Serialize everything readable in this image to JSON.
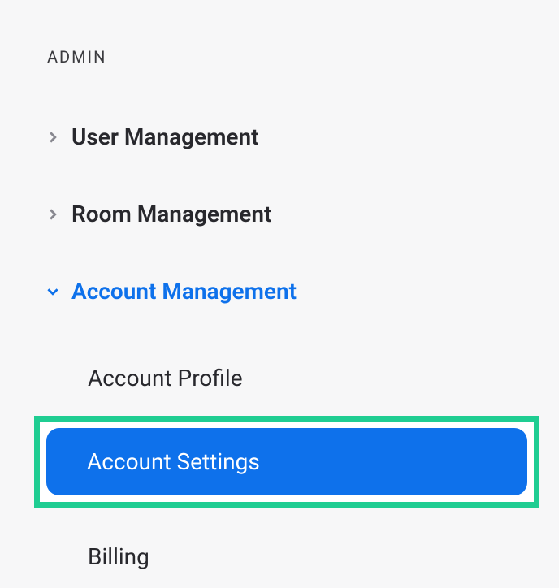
{
  "section": {
    "header": "ADMIN"
  },
  "nav": {
    "items": [
      {
        "label": "User Management",
        "expanded": false
      },
      {
        "label": "Room Management",
        "expanded": false
      },
      {
        "label": "Account Management",
        "expanded": true
      }
    ]
  },
  "sub": {
    "items": [
      {
        "label": "Account Profile",
        "active": false
      },
      {
        "label": "Account Settings",
        "active": true
      },
      {
        "label": "Billing",
        "active": false
      }
    ]
  }
}
